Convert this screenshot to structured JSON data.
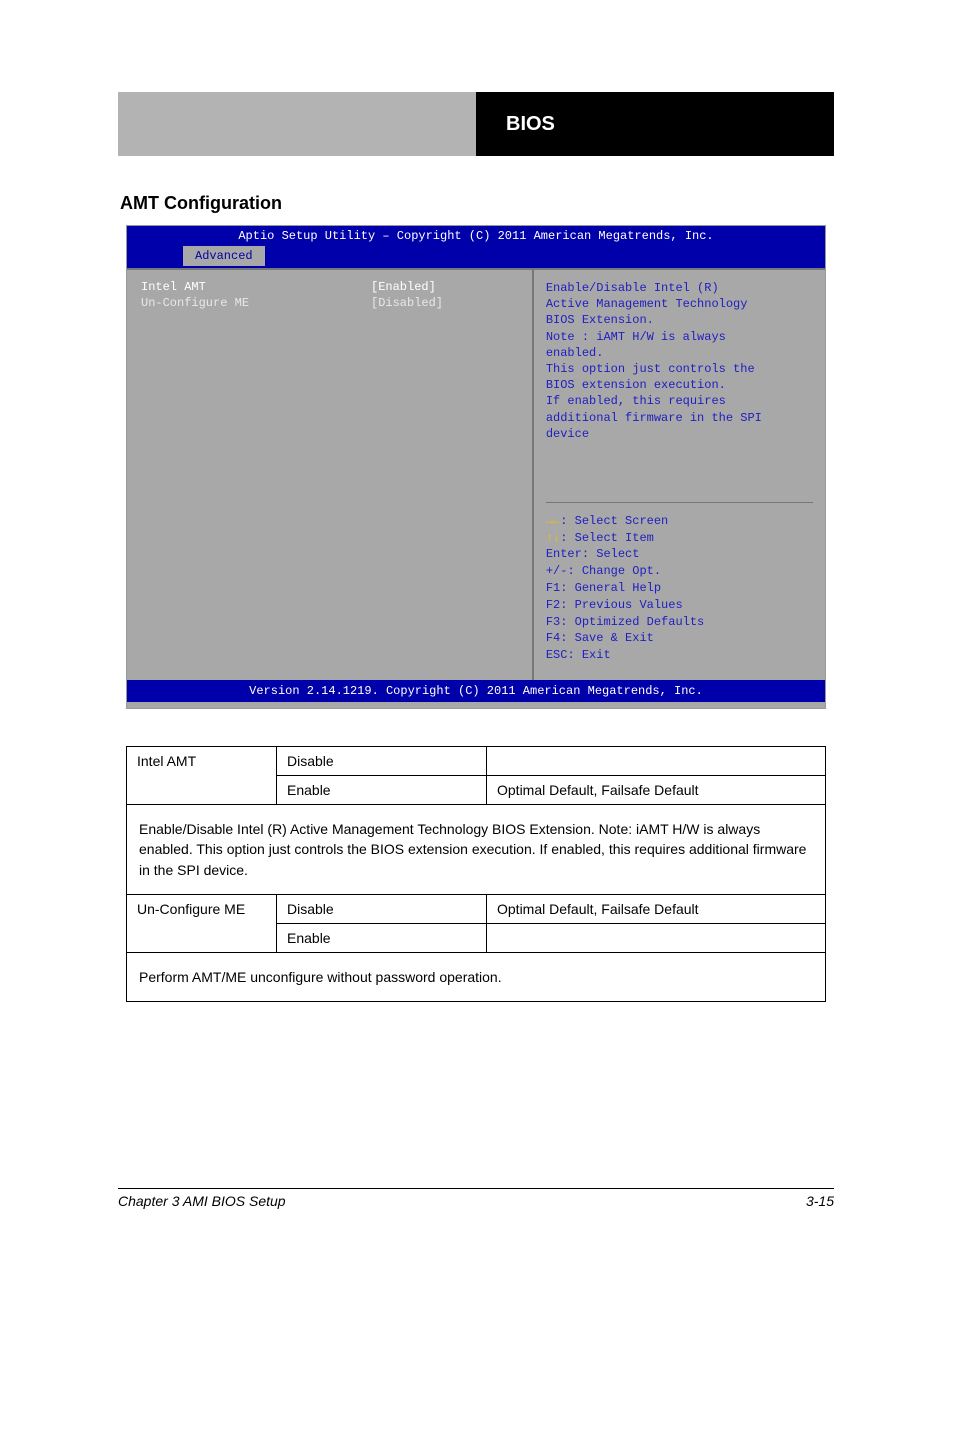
{
  "header": {
    "right_text": "BIOS"
  },
  "section_title": "AMT Configuration",
  "bios": {
    "title": "Aptio Setup Utility – Copyright (C) 2011 American Megatrends, Inc.",
    "tab": "Advanced",
    "items": [
      {
        "label": "Intel AMT",
        "value": "[Enabled]"
      },
      {
        "label": "Un-Configure ME",
        "value": "[Disabled]"
      }
    ],
    "help": [
      "Enable/Disable Intel (R)",
      "Active Management Technology",
      "BIOS Extension.",
      "Note : iAMT H/W is always",
      "enabled.",
      "This option just controls the",
      "BIOS extension execution.",
      "If enabled, this requires",
      "additional firmware in the SPI",
      "device"
    ],
    "nav": [
      {
        "sym": "→←",
        "text": ": Select Screen"
      },
      {
        "sym": "↑↓",
        "text": ": Select Item"
      },
      {
        "sym": "Enter",
        "text": ": Select",
        "nosym": true
      },
      {
        "sym": "+/-",
        "text": ": Change Opt.",
        "nosym": true
      },
      {
        "sym": "F1",
        "text": ": General Help",
        "nosym": true
      },
      {
        "sym": "F2",
        "text": ": Previous Values",
        "nosym": true
      },
      {
        "sym": "F3",
        "text": ": Optimized Defaults",
        "nosym": true
      },
      {
        "sym": "F4",
        "text": ": Save & Exit",
        "nosym": true
      },
      {
        "sym": "ESC",
        "text": ": Exit",
        "nosym": true
      }
    ],
    "footer": "Version 2.14.1219. Copyright (C) 2011 American Megatrends, Inc."
  },
  "table": {
    "rows": [
      {
        "name": "Intel AMT",
        "opts": [
          "Disable",
          "Enable"
        ],
        "defaults": [
          "",
          "Optimal Default, Failsafe Default"
        ],
        "desc": "Enable/Disable Intel (R) Active Management Technology BIOS Extension. Note: iAMT H/W is always enabled. This option just controls the BIOS extension execution. If enabled, this requires additional firmware in the SPI device."
      },
      {
        "name": "Un-Configure ME",
        "opts": [
          "Disable",
          "Enable"
        ],
        "defaults": [
          "Optimal Default, Failsafe Default",
          ""
        ],
        "desc": "Perform AMT/ME unconfigure without password operation."
      }
    ]
  },
  "footer": {
    "left": "Chapter 3 AMI BIOS Setup",
    "right": "3-15"
  }
}
